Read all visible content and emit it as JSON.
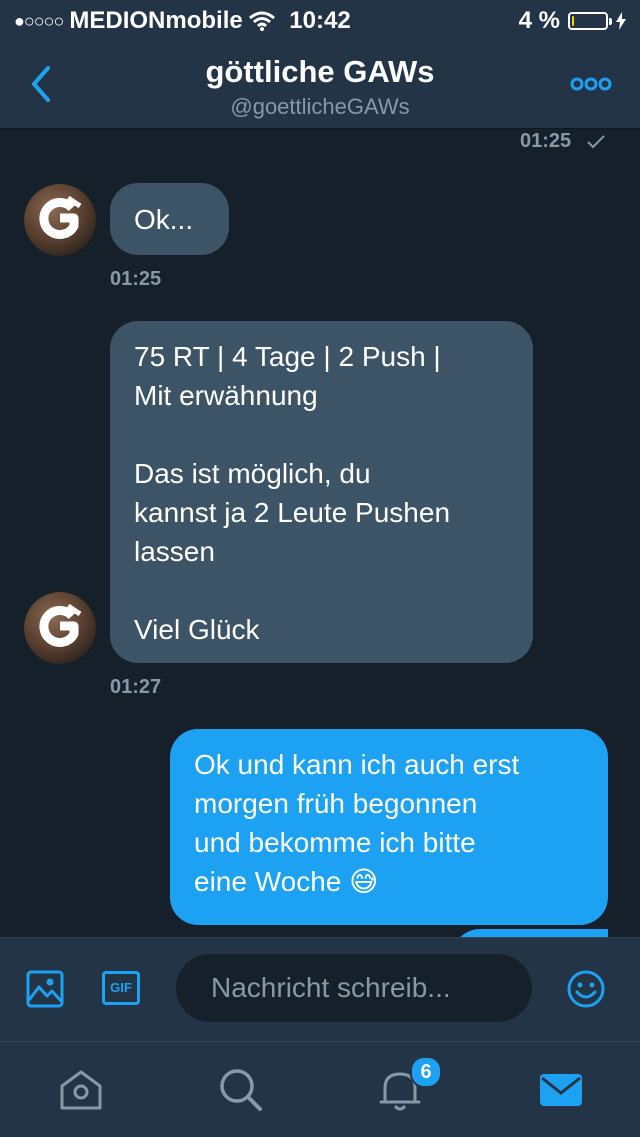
{
  "status_bar": {
    "signal_dots": "●○○○○",
    "carrier": "MEDIONmobile",
    "time": "10:42",
    "battery_label": "4 %",
    "battery_level": 0.04
  },
  "header": {
    "title": "göttliche GAWs",
    "handle": "@goettlicheGAWs"
  },
  "messages": [
    {
      "timestamp": "01:25"
    },
    {
      "text": "Ok...",
      "timestamp": "01:25"
    },
    {
      "text": "75 RT | 4 Tage | 2 Push |\nMit erwähnung\n\nDas ist möglich, du\nkannst ja 2 Leute Pushen\nlassen\n\nViel Glück",
      "timestamp": "01:27"
    },
    {
      "text": "Ok und kann ich auch erst\nmorgen früh begonnen\nund bekomme ich bitte\neine Woche 😅"
    }
  ],
  "composer": {
    "placeholder": "Nachricht schreib...",
    "gif_label": "GIF"
  },
  "tabbar": {
    "notifications_count": "6"
  },
  "colors": {
    "background": "#15202b",
    "bar": "#243447",
    "accent": "#1da1f2",
    "incoming_bubble": "#3d5466",
    "muted_text": "#8899a6"
  }
}
